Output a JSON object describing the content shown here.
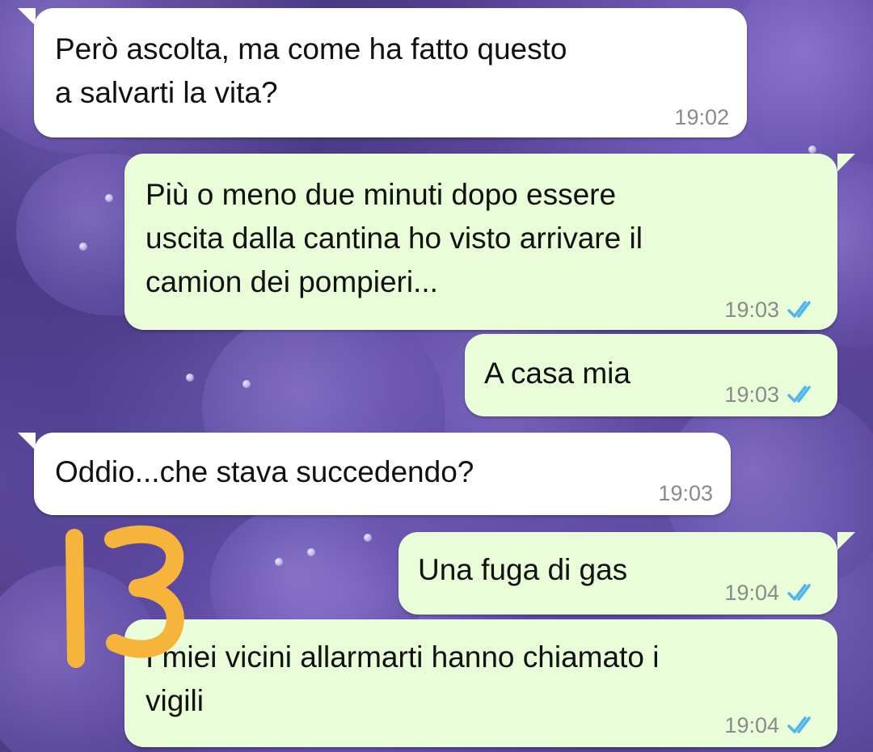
{
  "chat": {
    "messages": [
      {
        "direction": "incoming",
        "text": "Però ascolta, ma come ha fatto questo\na salvarti la vita?",
        "time": "19:02"
      },
      {
        "direction": "outgoing",
        "text": "Più o meno due minuti dopo essere\nuscita dalla cantina ho visto arrivare il\ncamion dei pompieri...",
        "time": "19:03",
        "status": "read"
      },
      {
        "direction": "outgoing",
        "text": "A casa mia",
        "time": "19:03",
        "status": "read"
      },
      {
        "direction": "incoming",
        "text": "Oddio...che stava succedendo?",
        "time": "19:03"
      },
      {
        "direction": "outgoing",
        "text": "Una fuga di gas",
        "time": "19:04",
        "status": "read"
      },
      {
        "direction": "outgoing",
        "text": "I miei vicini allarmarti hanno chiamato i\nvigili",
        "time": "19:04",
        "status": "read"
      }
    ]
  },
  "overlay": {
    "handwritten_number": "13",
    "color": "#f6b53a"
  },
  "colors": {
    "incoming_bubble": "#ffffff",
    "outgoing_bubble": "#e8fdd8",
    "read_ticks": "#4fb6ec",
    "timestamp": "#8a8a8a"
  },
  "icons": {
    "read_status": "double-check-icon"
  }
}
